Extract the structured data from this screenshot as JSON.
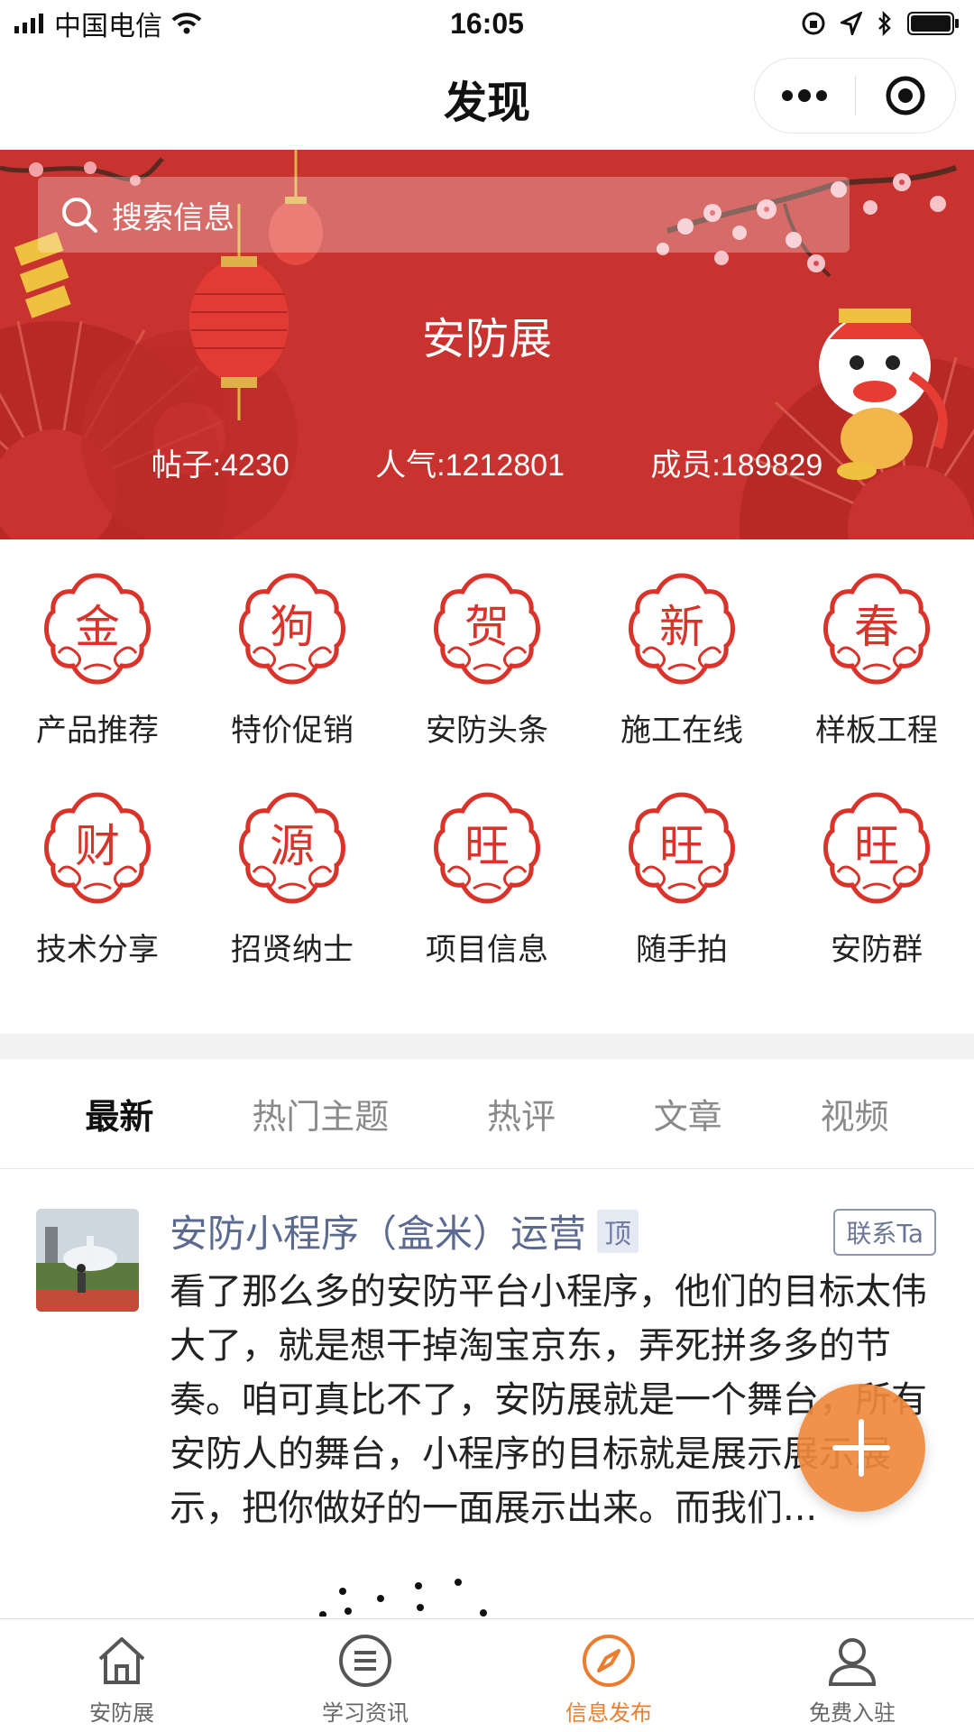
{
  "status_bar": {
    "carrier": "中国电信",
    "time": "16:05"
  },
  "nav": {
    "title": "发现"
  },
  "banner": {
    "search_placeholder": "搜索信息",
    "title": "安防展",
    "stats": [
      {
        "label": "帖子:4230"
      },
      {
        "label": "人气:1212801"
      },
      {
        "label": "成员:189829"
      }
    ]
  },
  "grid": {
    "items": [
      {
        "char": "金",
        "label": "产品推荐"
      },
      {
        "char": "狗",
        "label": "特价促销"
      },
      {
        "char": "贺",
        "label": "安防头条"
      },
      {
        "char": "新",
        "label": "施工在线"
      },
      {
        "char": "春",
        "label": "样板工程"
      },
      {
        "char": "财",
        "label": "技术分享"
      },
      {
        "char": "源",
        "label": "招贤纳士"
      },
      {
        "char": "旺",
        "label": "项目信息"
      },
      {
        "char": "旺",
        "label": "随手拍"
      },
      {
        "char": "旺",
        "label": "安防群"
      }
    ]
  },
  "tabs": [
    {
      "label": "最新",
      "active": true
    },
    {
      "label": "热门主题",
      "active": false
    },
    {
      "label": "热评",
      "active": false
    },
    {
      "label": "文章",
      "active": false
    },
    {
      "label": "视频",
      "active": false
    }
  ],
  "post": {
    "author": "安防小程序（盒米）运营",
    "top_badge": "顶",
    "contact_label": "联系Ta",
    "body": "看了那么多的安防平台小程序，他们的目标太伟大了，就是想干掉淘宝京东，弄死拼多多的节奏。咱可真比不了，安防展就是一个舞台，所有安防人的舞台，小程序的目标就是展示展示展示，把你做好的一面展示出来。而我们..."
  },
  "tabbar": {
    "items": [
      {
        "label": "安防展",
        "icon": "home-icon",
        "active": false
      },
      {
        "label": "学习资讯",
        "icon": "list-icon",
        "active": false
      },
      {
        "label": "信息发布",
        "icon": "compass-icon",
        "active": true
      },
      {
        "label": "免费入驻",
        "icon": "user-icon",
        "active": false
      }
    ]
  },
  "colors": {
    "banner_red": "#c8322f",
    "accent_orange": "#ec7d2e",
    "author_blue": "#5b6a91",
    "badge_red": "#d9342b"
  }
}
